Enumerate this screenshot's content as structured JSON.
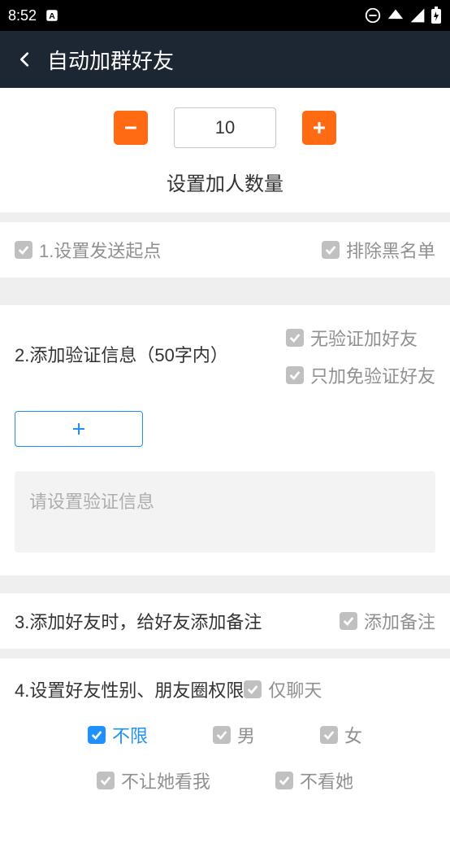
{
  "status": {
    "time": "8:52"
  },
  "header": {
    "title": "自动加群好友"
  },
  "counter": {
    "value": "10",
    "label": "设置加人数量"
  },
  "row1": {
    "title": "1.设置发送起点",
    "blacklist": "排除黑名单"
  },
  "section2": {
    "title": "2.添加验证信息（50字内）",
    "no_verify": "无验证加好友",
    "only_no_verify": "只加免验证好友",
    "placeholder": "请设置验证信息"
  },
  "row3": {
    "title": "3.添加好友时，给好友添加备注",
    "add_remark": "添加备注"
  },
  "row4": {
    "title": "4.设置好友性别、朋友圈权限",
    "only_chat": "仅聊天",
    "gender_any": "不限",
    "gender_male": "男",
    "gender_female": "女",
    "hide_my": "不让她看我",
    "hide_her": "不看她"
  }
}
